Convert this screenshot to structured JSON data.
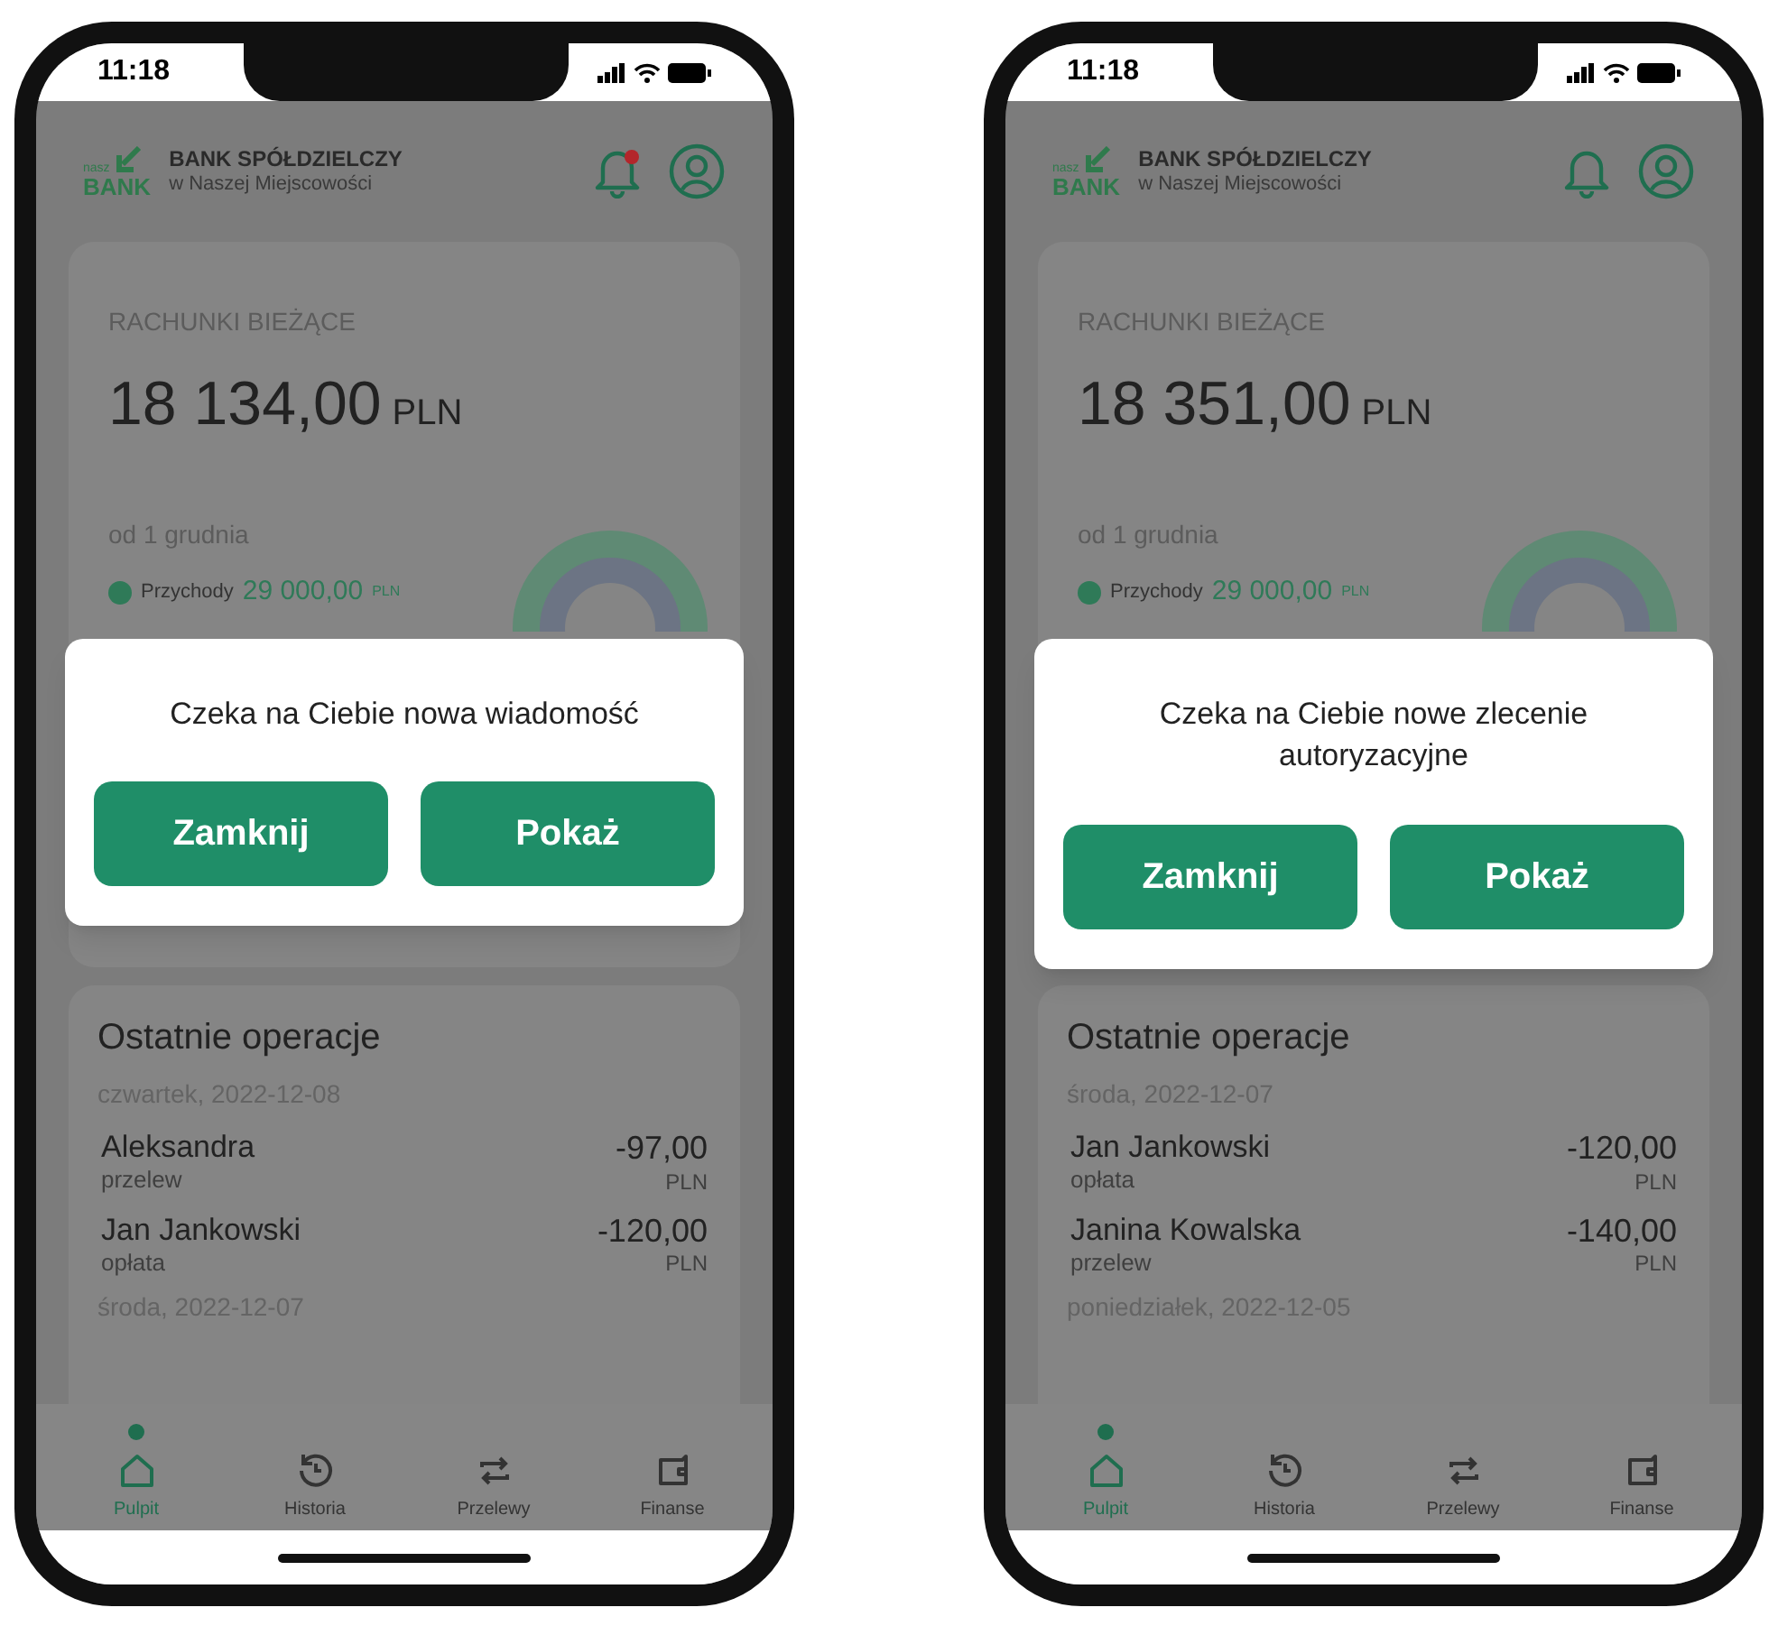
{
  "phones": [
    {
      "status_time": "11:18",
      "bank": {
        "logo_small": "nasz",
        "logo": "BANK",
        "name": "BANK SPÓŁDZIELCZY",
        "subtitle": "w Naszej Miejscowości"
      },
      "notification_badge": true,
      "accounts": {
        "title": "RACHUNKI BIEŻĄCE",
        "amount": "18 134",
        "decimals": ",00",
        "currency": "PLN",
        "period": "od 1 grudnia",
        "income": {
          "label": "Przychody",
          "amount": "29 000",
          "decimals": ",00",
          "currency": "PLN"
        }
      },
      "dialog": {
        "message": "Czeka na Ciebie nowa wiadomość",
        "buttons": [
          "Zamknij",
          "Pokaż"
        ]
      },
      "operations": {
        "title": "Ostatnie operacje",
        "groups": [
          {
            "date": "czwartek, 2022-12-08",
            "items": [
              {
                "name": "Aleksandra",
                "type": "przelew",
                "amount": "-97,00",
                "currency": "PLN"
              },
              {
                "name": "Jan Jankowski",
                "type": "opłata",
                "amount": "-120,00",
                "currency": "PLN"
              }
            ]
          },
          {
            "date": "środa, 2022-12-07"
          }
        ]
      },
      "nav": [
        {
          "kind": "home",
          "label": "Pulpit",
          "selected": true
        },
        {
          "kind": "history",
          "label": "Historia",
          "selected": false
        },
        {
          "kind": "transfer",
          "label": "Przelewy",
          "selected": false
        },
        {
          "kind": "wallet",
          "label": "Finanse",
          "selected": false
        }
      ]
    },
    {
      "status_time": "11:18",
      "bank": {
        "logo_small": "nasz",
        "logo": "BANK",
        "name": "BANK SPÓŁDZIELCZY",
        "subtitle": "w Naszej Miejscowości"
      },
      "notification_badge": false,
      "accounts": {
        "title": "RACHUNKI BIEŻĄCE",
        "amount": "18 351",
        "decimals": ",00",
        "currency": "PLN",
        "period": "od 1 grudnia",
        "income": {
          "label": "Przychody",
          "amount": "29 000",
          "decimals": ",00",
          "currency": "PLN"
        }
      },
      "dialog": {
        "message": "Czeka na Ciebie nowe zlecenie autoryzacyjne",
        "buttons": [
          "Zamknij",
          "Pokaż"
        ]
      },
      "operations": {
        "title": "Ostatnie operacje",
        "groups": [
          {
            "date": "środa, 2022-12-07",
            "items": [
              {
                "name": "Jan Jankowski",
                "type": "opłata",
                "amount": "-120,00",
                "currency": "PLN"
              },
              {
                "name": "Janina Kowalska",
                "type": "przelew",
                "amount": "-140,00",
                "currency": "PLN"
              }
            ]
          },
          {
            "date": "poniedziałek, 2022-12-05"
          }
        ]
      },
      "nav": [
        {
          "kind": "home",
          "label": "Pulpit",
          "selected": true
        },
        {
          "kind": "history",
          "label": "Historia",
          "selected": false
        },
        {
          "kind": "transfer",
          "label": "Przelewy",
          "selected": false
        },
        {
          "kind": "wallet",
          "label": "Finanse",
          "selected": false
        }
      ]
    }
  ]
}
